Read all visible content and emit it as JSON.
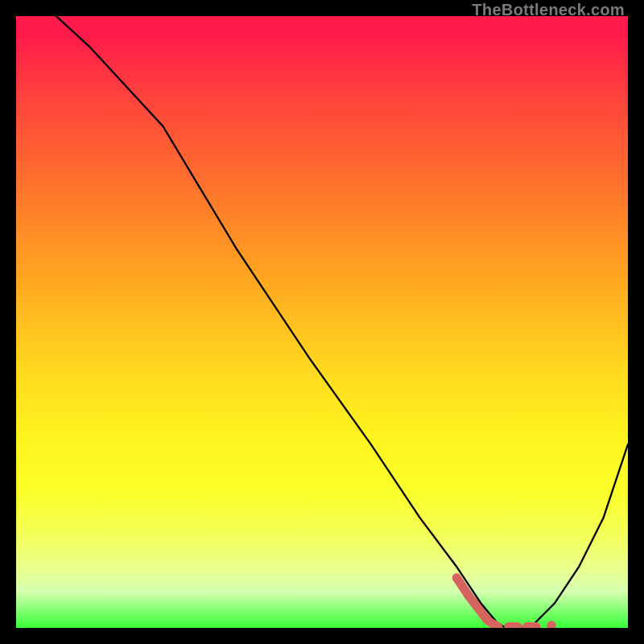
{
  "attribution": "TheBottleneck.com",
  "colors": {
    "frame": "#000000",
    "curve": "#000000",
    "accent": "#d6635f"
  },
  "chart_data": {
    "type": "line",
    "title": "",
    "xlabel": "",
    "ylabel": "",
    "xlim": [
      0,
      100
    ],
    "ylim": [
      0,
      100
    ],
    "series": [
      {
        "name": "main-curve",
        "x": [
          0,
          12,
          24,
          36,
          48,
          58,
          66,
          72,
          76,
          78.5,
          80,
          84,
          88,
          92,
          96,
          100
        ],
        "y": [
          106,
          95,
          82,
          62,
          44,
          30,
          18,
          10,
          4,
          1,
          0,
          0,
          4,
          10,
          18,
          30
        ]
      },
      {
        "name": "accent-elbow",
        "x": [
          72,
          74,
          76,
          77,
          78,
          78.8
        ],
        "y": [
          8.2,
          5.2,
          2.6,
          1.3,
          0.6,
          0.2
        ]
      },
      {
        "name": "accent-dash-1",
        "x": [
          80.5,
          82
        ],
        "y": [
          0.2,
          0.2
        ]
      },
      {
        "name": "accent-dash-2",
        "x": [
          83.5,
          85
        ],
        "y": [
          0.2,
          0.2
        ]
      }
    ],
    "points": [
      {
        "name": "accent-dot",
        "x": 87.5,
        "y": 0.4
      }
    ]
  }
}
